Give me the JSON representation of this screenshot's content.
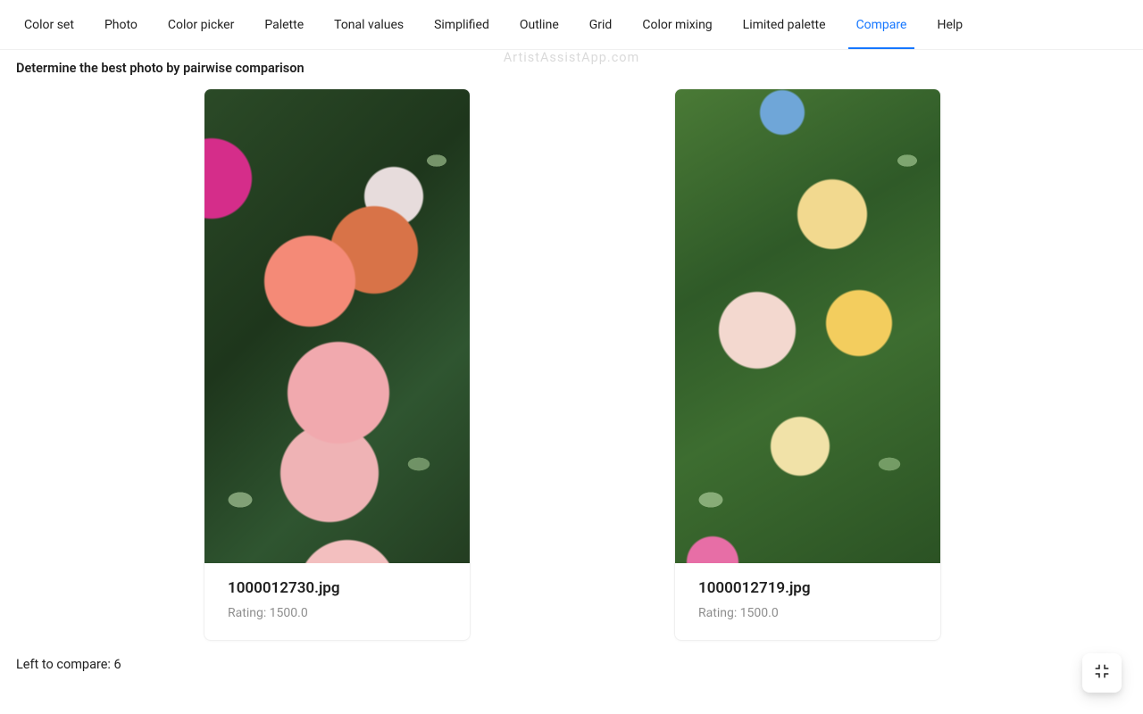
{
  "watermark": "ArtistAssistApp.com",
  "tabs": [
    {
      "label": "Color set",
      "active": false
    },
    {
      "label": "Photo",
      "active": false
    },
    {
      "label": "Color picker",
      "active": false
    },
    {
      "label": "Palette",
      "active": false
    },
    {
      "label": "Tonal values",
      "active": false
    },
    {
      "label": "Simplified",
      "active": false
    },
    {
      "label": "Outline",
      "active": false
    },
    {
      "label": "Grid",
      "active": false
    },
    {
      "label": "Color mixing",
      "active": false
    },
    {
      "label": "Limited palette",
      "active": false
    },
    {
      "label": "Compare",
      "active": true
    },
    {
      "label": "Help",
      "active": false
    }
  ],
  "heading": "Determine the best photo by pairwise comparison",
  "cards": [
    {
      "filename": "1000012730.jpg",
      "rating_line": "Rating: 1500.0"
    },
    {
      "filename": "1000012719.jpg",
      "rating_line": "Rating: 1500.0"
    }
  ],
  "left_to_compare": "Left to compare: 6",
  "float_button_icon": "fullscreen-exit-icon"
}
